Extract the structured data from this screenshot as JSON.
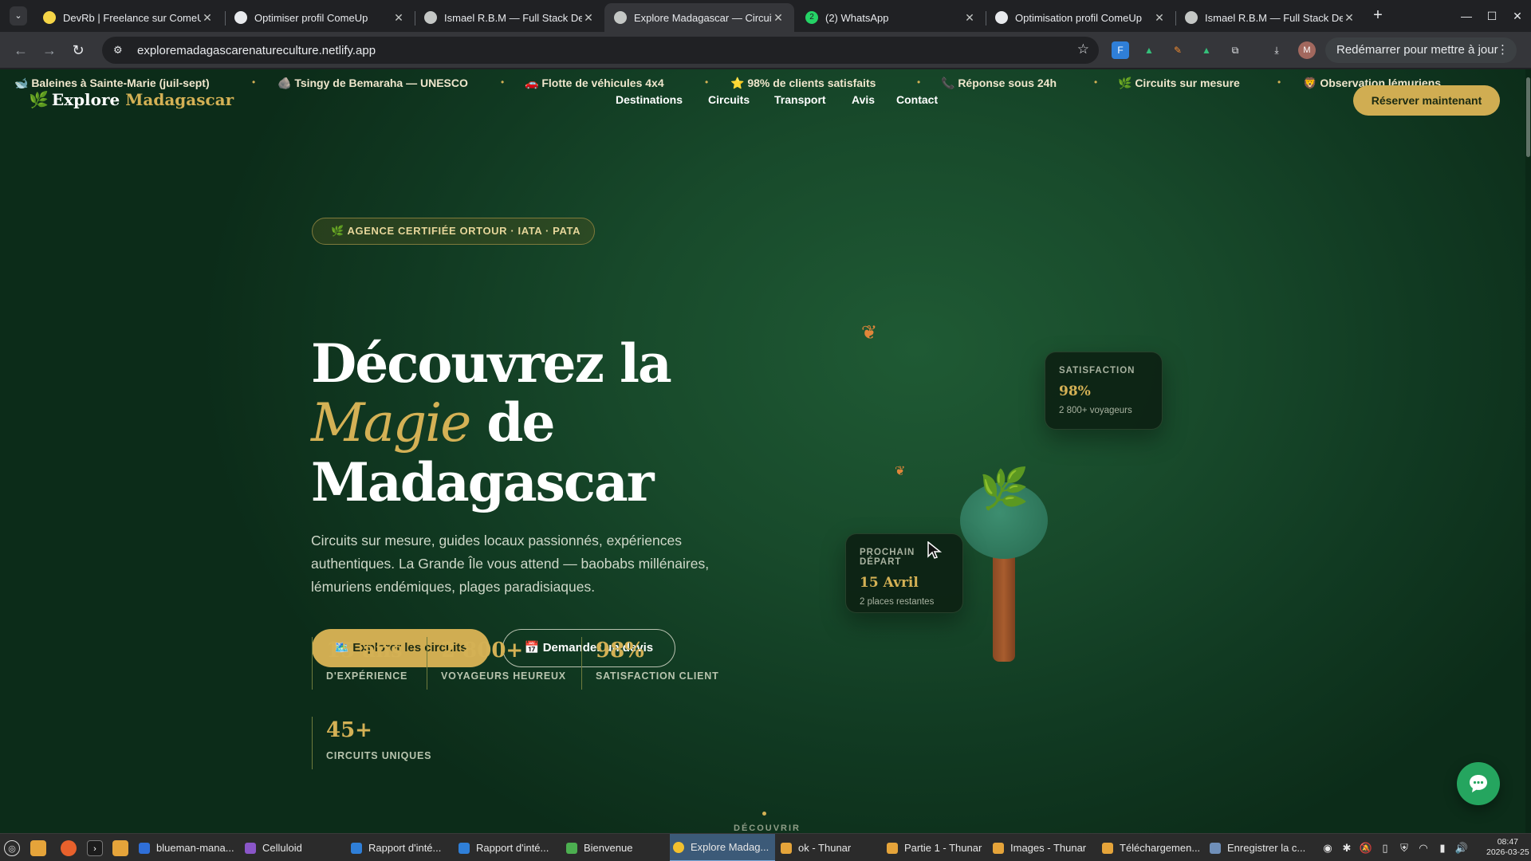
{
  "browser": {
    "tabs": [
      {
        "title": "DevRb | Freelance sur ComeUp",
        "favicon_color": "#f5d547"
      },
      {
        "title": "Optimiser profil ComeUp",
        "favicon_color": "#e8eaed"
      },
      {
        "title": "Ismael R.B.M — Full Stack Developer",
        "favicon_color": "#e8eaed"
      },
      {
        "title": "Explore Madagascar — Circuits",
        "favicon_color": "#e8eaed"
      },
      {
        "title": "(2) WhatsApp",
        "favicon_color": "#25d366",
        "favicon_text": "2"
      },
      {
        "title": "Optimisation profil ComeUp",
        "favicon_color": "#e8eaed"
      },
      {
        "title": "Ismael R.B.M — Full Stack Developer",
        "favicon_color": "#e8eaed"
      }
    ],
    "url": "exploremadagascarenatureculture.netlify.app",
    "restart_label": "Redémarrer pour mettre à jour",
    "avatar_letter": "M"
  },
  "ticker": [
    "🐋 Baleines à Sainte-Marie (juil-sept)",
    "🪨 Tsingy de Bemaraha — UNESCO",
    "🚗 Flotte de véhicules 4x4",
    "⭐ 98% de clients satisfaits",
    "📞 Réponse sous 24h",
    "🌿 Circuits sur mesure",
    "🦁 Observation lémuriens"
  ],
  "header": {
    "brand_word1": "Explore",
    "brand_word2": "Madagascar",
    "nav": [
      "Destinations",
      "Circuits",
      "Transport",
      "Avis",
      "Contact"
    ],
    "cta": "Réserver maintenant"
  },
  "hero": {
    "badge": "🌿 AGENCE CERTIFIÉE ORTOUR · IATA · PATA",
    "title_line1": "Découvrez la",
    "title_magie": "Magie",
    "title_de": " de",
    "title_line3": "Madagascar",
    "lead": "Circuits sur mesure, guides locaux passionnés, expériences authentiques. La Grande Île vous attend — baobabs millénaires, lémuriens endémiques, plages paradisiaques.",
    "btn_primary": "🗺️ Explorer les circuits",
    "btn_secondary": "📅 Demander un devis"
  },
  "stats": [
    {
      "value": "15 ans",
      "label": "D'EXPÉRIENCE"
    },
    {
      "value": "2 800+",
      "label": "VOYAGEURS HEUREUX"
    },
    {
      "value": "98%",
      "label": "SATISFACTION CLIENT"
    },
    {
      "value": "45+",
      "label": "CIRCUITS UNIQUES"
    }
  ],
  "cards": {
    "satisfaction": {
      "label": "SATISFACTION",
      "value": "98%",
      "sub": "2 800+ voyageurs"
    },
    "next_departure": {
      "label": "PROCHAIN DÉPART",
      "value": "15 Avril",
      "sub": "2 places restantes"
    }
  },
  "scroll_label": "DÉCOUVRIR",
  "taskbar": {
    "items": [
      "blueman-mana...",
      "Celluloid",
      "Rapport d'inté...",
      "Rapport d'inté...",
      "Bienvenue",
      "Explore Madag...",
      "ok - Thunar",
      "Partie 1 - Thunar",
      "Images - Thunar",
      "Téléchargemen...",
      "Enregistrer la c..."
    ],
    "time": "08:47",
    "date": "2026-03-25"
  },
  "colors": {
    "gold": "#d4b155",
    "green_bg": "#184a2b",
    "chat": "#25a55f"
  }
}
